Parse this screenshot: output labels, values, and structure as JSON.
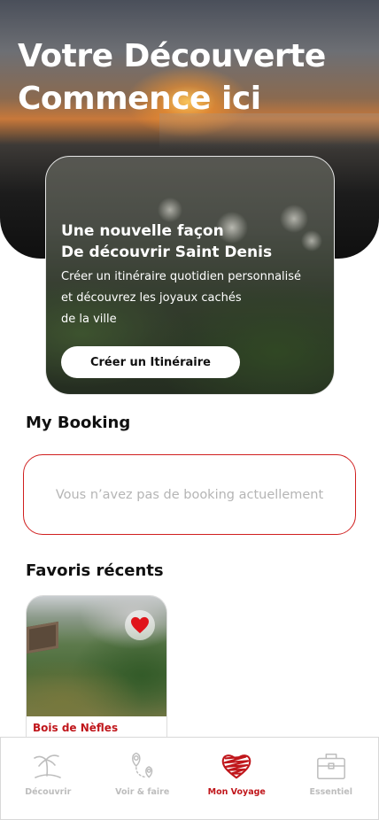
{
  "hero": {
    "title_line1": "Votre Découverte",
    "title_line2": "Commence ici"
  },
  "promo": {
    "title_line1": "Une nouvelle façon",
    "title_line2": "De découvrir Saint Denis",
    "desc_line1": "Créer un itinéraire quotidien personnalisé",
    "desc_line2": "et découvrez les joyaux cachés",
    "desc_line3": "de la ville",
    "button_label": "Créer un Itinéraire"
  },
  "booking": {
    "section_title": "My Booking",
    "empty_message": "Vous n’avez pas de booking actuellement"
  },
  "favorites": {
    "section_title": "Favoris récents",
    "items": [
      {
        "name": "Bois de Nèfles",
        "favorited": true,
        "icon": "heart-icon"
      }
    ]
  },
  "tabbar": {
    "tabs": [
      {
        "label": "Découvrir",
        "icon": "palm-tree-icon",
        "active": false
      },
      {
        "label": "Voir & faire",
        "icon": "map-pin-route-icon",
        "active": false
      },
      {
        "label": "Mon Voyage",
        "icon": "scribble-heart-icon",
        "active": true
      },
      {
        "label": "Essentiel",
        "icon": "suitcase-icon",
        "active": false
      }
    ]
  },
  "colors": {
    "accent": "#c0161b",
    "inactive": "#bdbdbd",
    "booking_border": "#d01f1f"
  }
}
